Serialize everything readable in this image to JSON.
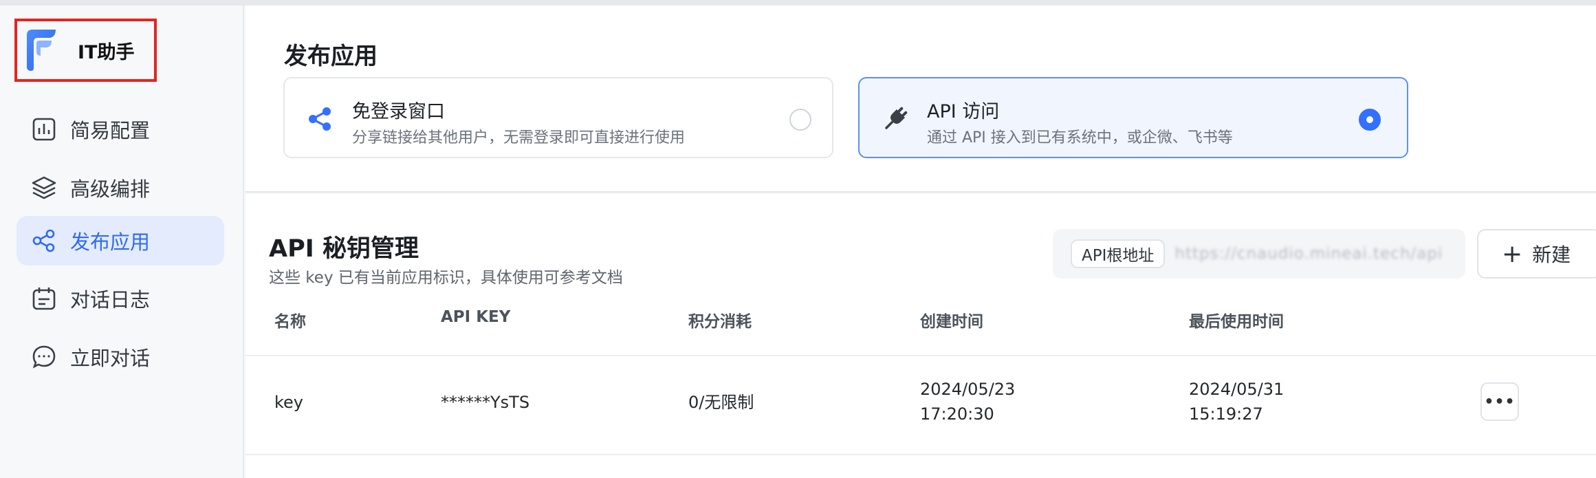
{
  "brand": {
    "name": "IT助手"
  },
  "sidebar": {
    "items": [
      {
        "label": "简易配置",
        "icon": "bar-chart-icon"
      },
      {
        "label": "高级编排",
        "icon": "layers-icon"
      },
      {
        "label": "发布应用",
        "icon": "share-icon",
        "active": true
      },
      {
        "label": "对话日志",
        "icon": "calendar-log-icon"
      },
      {
        "label": "立即对话",
        "icon": "chat-bubble-icon"
      }
    ]
  },
  "publish": {
    "title": "发布应用",
    "options": [
      {
        "title": "免登录窗口",
        "desc": "分享链接给其他用户，无需登录即可直接进行使用",
        "icon": "share-icon",
        "selected": false
      },
      {
        "title": "API 访问",
        "desc": "通过 API 接入到已有系统中，或企微、飞书等",
        "icon": "plug-icon",
        "selected": true
      }
    ]
  },
  "api_keys": {
    "title": "API 秘钥管理",
    "subtitle": "这些 key 已有当前应用标识，具体使用可参考文档",
    "root_label": "API根地址",
    "root_url": "https://cnaudio.mineai.tech/api",
    "new_label": "新建",
    "columns": [
      "名称",
      "API KEY",
      "积分消耗",
      "创建时间",
      "最后使用时间"
    ],
    "rows": [
      {
        "name": "key",
        "api_key": "******YsTS",
        "usage": "0/无限制",
        "created_date": "2024/05/23",
        "created_time": "17:20:30",
        "last_used_date": "2024/05/31",
        "last_used_time": "15:19:27",
        "more": "•••"
      }
    ]
  },
  "colors": {
    "accent": "#3370ff",
    "active_bg": "#e3ebfd",
    "brand_highlight": "#e5231f"
  }
}
